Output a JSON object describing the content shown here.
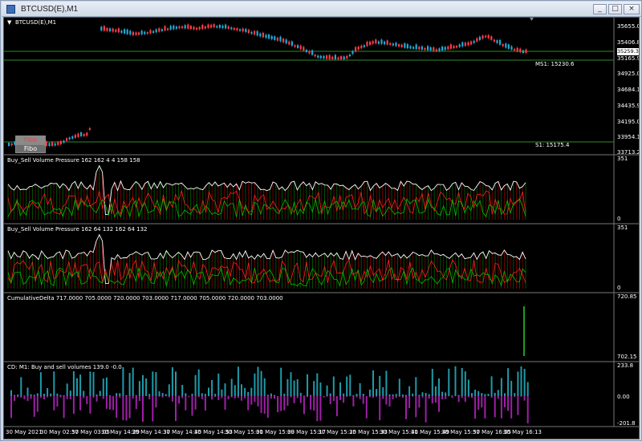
{
  "window": {
    "title": "BTCUSD(E),M1",
    "min_label": "_",
    "max_label": "□",
    "close_label": "×"
  },
  "chart": {
    "symbol_label": "BTCUSD(E),M1",
    "collapse_glyph": "▼",
    "price_axis": [
      "35655.00",
      "35406.80",
      "35165.90",
      "34925.00",
      "34684.10",
      "34435.90",
      "34195.00",
      "33954.10",
      "33713.20"
    ],
    "current_price": "35259.30",
    "ms1_label": "MS1: 15230.6",
    "s1_label": "S1: 15175.4",
    "fibo_red_label": "Fibo",
    "fibo_label": "Fibo",
    "colors": {
      "up": "#1fa9d6",
      "down": "#ff3b46",
      "sr_line": "#2e8b2e"
    }
  },
  "indicators": {
    "volume1": {
      "label": "Buy_Sell Volume Pressure 162 162 4 4 158 158",
      "max": "351",
      "min": "0"
    },
    "volume2": {
      "label": "Buy_Sell Volume Pressure 162 64 132 162 64 132",
      "max": "351",
      "min": "0"
    },
    "cumdelta": {
      "label": "CumulativeDelta 717.0000 705.0000 720.0000 703.0000 717.0000 705.0000 720.0000 703.0000",
      "max": "720.85",
      "min": "702.15"
    },
    "cd": {
      "label": "CD: M1: Buy and sell volumes 139.0 -0.0",
      "max": "233.8",
      "zero": "0.00",
      "min": "-201.8"
    }
  },
  "time_axis": [
    "30 May 2021",
    "30 May 02:57",
    "30 May 03:05",
    "30 May 14:29",
    "30 May 14:37",
    "30 May 14:45",
    "30 May 14:53",
    "30 May 15:01",
    "30 May 15:09",
    "30 May 15:17",
    "30 May 15:25",
    "30 May 15:33",
    "30 May 15:41",
    "30 May 15:49",
    "30 May 15:57",
    "30 May 16:05",
    "30 May 16:13"
  ]
}
